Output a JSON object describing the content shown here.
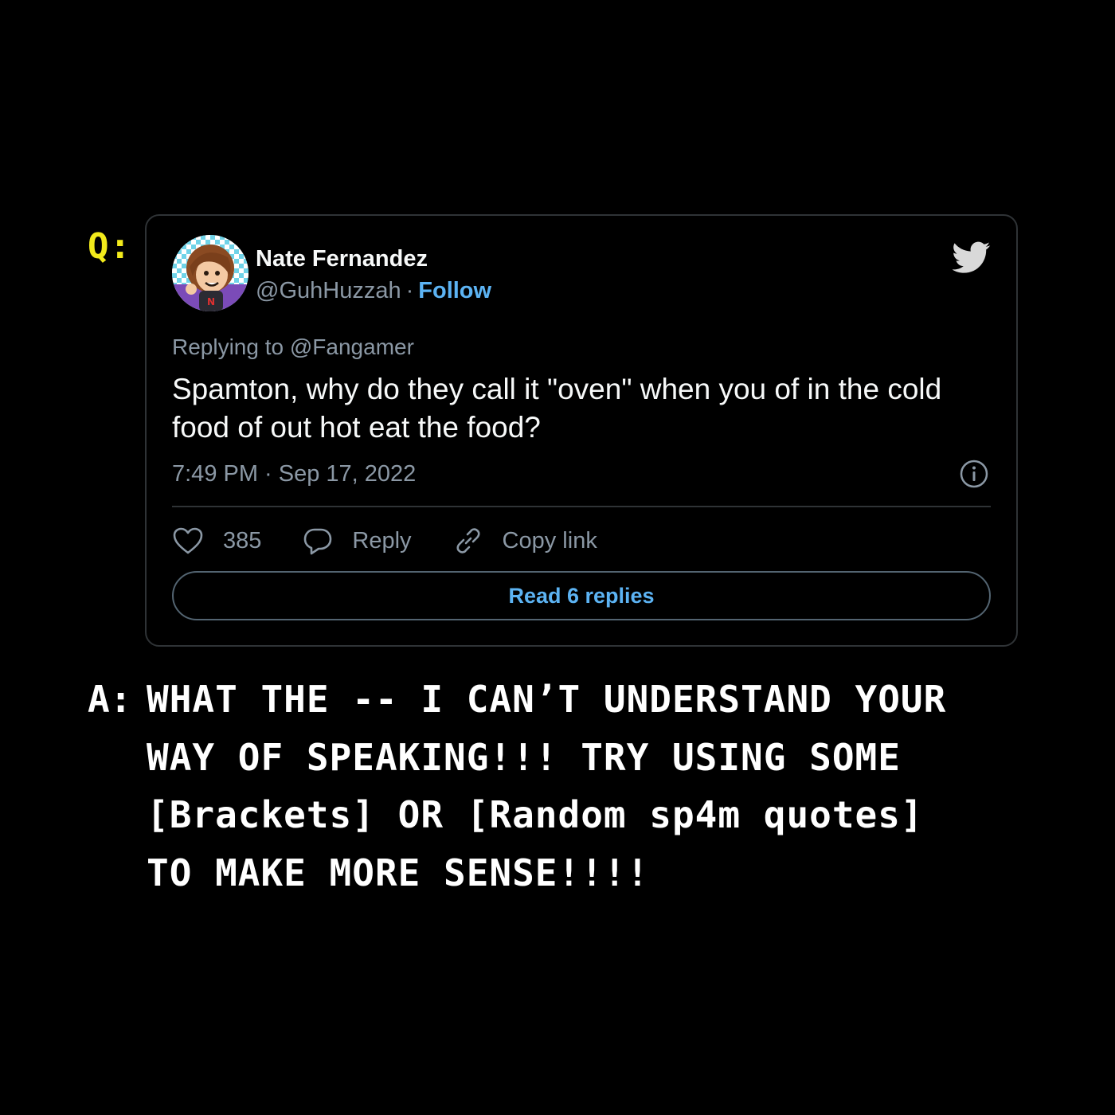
{
  "question_label": "Q:",
  "answer_label": "A:",
  "tweet": {
    "author_name": "Nate Fernandez",
    "author_handle": "@GuhHuzzah",
    "separator": "·",
    "follow_label": "Follow",
    "replying_prefix": "Replying to",
    "replying_to": "@Fangamer",
    "text": "Spamton, why do they call it \"oven\" when you of in the cold food of out hot eat the food?",
    "timestamp": "7:49 PM · Sep 17, 2022",
    "likes_count": "385",
    "reply_label": "Reply",
    "copy_link_label": "Copy link",
    "read_replies_label": "Read 6 replies",
    "icons": {
      "brand": "twitter-bird-icon",
      "info": "info-icon",
      "like": "heart-icon",
      "reply": "speech-bubble-icon",
      "copy": "link-icon"
    }
  },
  "answer_lines": [
    "WHAT THE -- I CAN’T UNDERSTAND YOUR",
    "WAY OF SPEAKING!!! TRY USING SOME",
    "[Brackets] OR [Random sp4m quotes]",
    "TO MAKE MORE SENSE!!!!"
  ],
  "colors": {
    "background": "#000000",
    "question_accent": "#f2ea1b",
    "link_blue": "#5cb3f3",
    "muted_text": "#8b98a5",
    "card_border": "#2f3336"
  }
}
